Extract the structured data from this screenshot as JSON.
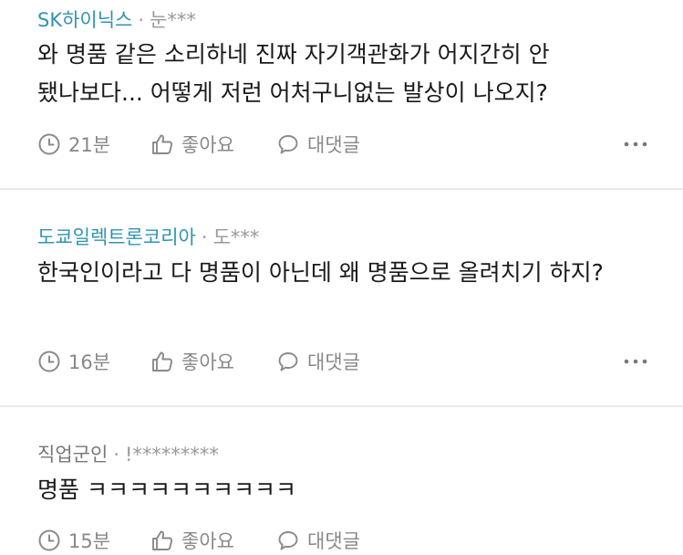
{
  "comments": [
    {
      "author": "SK하이닉스",
      "separator": "·",
      "masked_user": "눈***",
      "text": "와 명품 같은 소리하네 진짜 자기객관화가 어지간히 안 됐나보다... 어떻게 저런 어처구니없는 발상이 나오지?",
      "time": "21분",
      "like_label": "좋아요",
      "reply_label": "대댓글"
    },
    {
      "author": "도쿄일렉트론코리아",
      "separator": "·",
      "masked_user": "도***",
      "text": "한국인이라고 다 명품이 아닌데 왜 명품으로 올려치기 하지?",
      "time": "16분",
      "like_label": "좋아요",
      "reply_label": "대댓글"
    },
    {
      "author": "직업군인",
      "separator": "·",
      "masked_user": "!*********",
      "text": "명품 ㅋㅋㅋㅋㅋㅋㅋㅋㅋㅋ",
      "time": "15분",
      "like_label": "좋아요",
      "reply_label": "대댓글"
    }
  ],
  "icons": {
    "time": "clock-icon",
    "like": "thumbs-up-icon",
    "reply": "speech-bubble-icon",
    "more": "more-dots-icon"
  },
  "colors": {
    "company_author": "#2f94b3",
    "plain_author": "#777777",
    "meta_gray": "#888888",
    "divider": "#e9e9e9"
  }
}
